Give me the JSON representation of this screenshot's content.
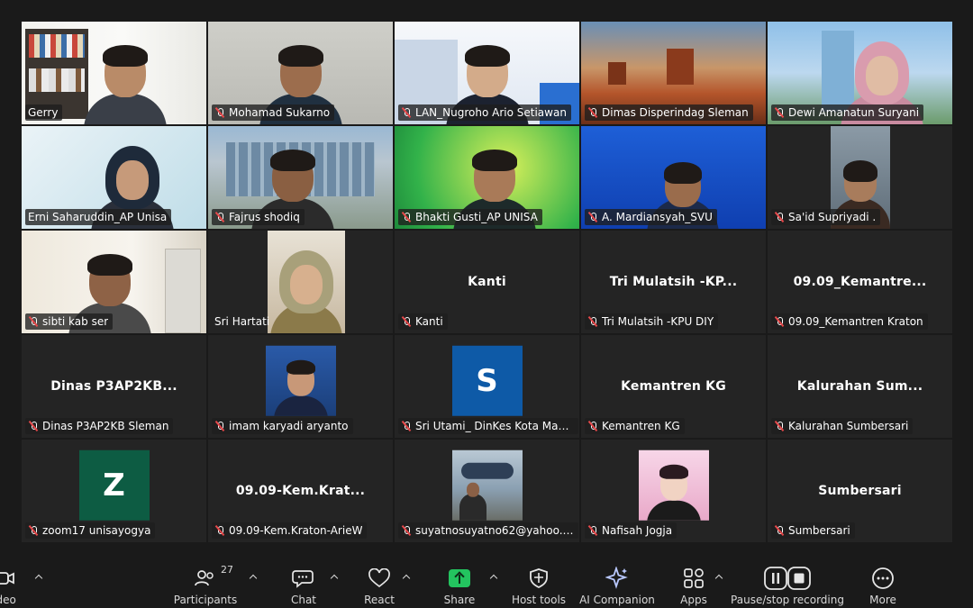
{
  "gallery": {
    "tiles": [
      {
        "name": "Gerry",
        "muted": false
      },
      {
        "name": "Mohamad Sukarno",
        "muted": true
      },
      {
        "name": "LAN_Nugroho Ario Setiawan",
        "muted": true
      },
      {
        "name": "Dimas Disperindag Sleman",
        "muted": true
      },
      {
        "name": "Dewi Amanatun Suryani",
        "muted": true
      },
      {
        "name": "Erni Saharuddin_AP Unisa",
        "muted": false
      },
      {
        "name": "Fajrus shodiq",
        "muted": true
      },
      {
        "name": "Bhakti Gusti_AP UNISA",
        "muted": true
      },
      {
        "name": "A. Mardiansyah_SVU",
        "muted": true
      },
      {
        "name": "Sa'id Supriyadi .",
        "muted": true
      },
      {
        "name": "sibti kab ser",
        "muted": true
      },
      {
        "name": "Sri Hartati",
        "muted": false
      },
      {
        "name": "Kanti",
        "muted": true,
        "center_text": "Kanti"
      },
      {
        "name": "Tri Mulatsih -KPU DIY",
        "muted": true,
        "center_text": "Tri  Mulatsih  -KP..."
      },
      {
        "name": "09.09_Kemantren Kraton",
        "muted": true,
        "center_text": "09.09_Kemantre..."
      },
      {
        "name": "Dinas P3AP2KB Sleman",
        "muted": true,
        "center_text": "Dinas  P3AP2KB..."
      },
      {
        "name": "imam karyadi aryanto",
        "muted": true
      },
      {
        "name": "Sri Utami_ DinKes Kota Magel...",
        "muted": true,
        "avatar_letter": "S"
      },
      {
        "name": "Kemantren KG",
        "muted": true,
        "center_text": "Kemantren KG"
      },
      {
        "name": "Kalurahan Sumbersari",
        "muted": true,
        "center_text": "Kalurahan  Sum..."
      },
      {
        "name": "zoom17 unisayogya",
        "muted": true,
        "avatar_letter": "Z"
      },
      {
        "name": "09.09-Kem.Kraton-ArieW",
        "muted": true,
        "center_text": "09.09-Kem.Krat..."
      },
      {
        "name": "suyatnosuyatno62@yahoo.com",
        "muted": true
      },
      {
        "name": "Nafisah Jogja",
        "muted": true
      },
      {
        "name": "Sumbersari",
        "muted": true,
        "center_text": "Sumbersari"
      }
    ]
  },
  "toolbar": {
    "video_label": "ideo",
    "participants_label": "Participants",
    "participants_count": "27",
    "chat_label": "Chat",
    "react_label": "React",
    "share_label": "Share",
    "host_tools_label": "Host tools",
    "ai_companion_label": "AI Companion",
    "apps_label": "Apps",
    "recording_label": "Pause/stop recording",
    "more_label": "More"
  },
  "colors": {
    "active_speaker": "#23d160",
    "share_green": "#23c45f",
    "muted_red": "#e8484a",
    "avatar_s": "#0e5aa7",
    "avatar_z": "#0d5c43"
  }
}
